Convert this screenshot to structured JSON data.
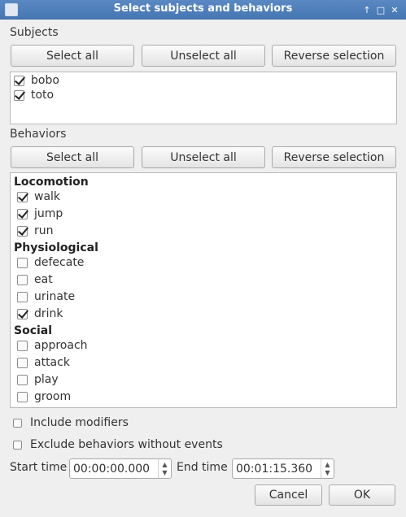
{
  "window": {
    "title": "Select subjects and behaviors",
    "controls": [
      "↑",
      "□",
      "✕"
    ]
  },
  "subjects": {
    "label": "Subjects",
    "select_all": "Select all",
    "unselect_all": "Unselect all",
    "reverse": "Reverse selection",
    "items": [
      {
        "label": "bobo",
        "checked": true
      },
      {
        "label": "toto",
        "checked": true
      }
    ]
  },
  "behaviors": {
    "label": "Behaviors",
    "select_all": "Select all",
    "unselect_all": "Unselect all",
    "reverse": "Reverse selection",
    "groups": [
      {
        "name": "Locomotion",
        "items": [
          {
            "label": "walk",
            "checked": true
          },
          {
            "label": "jump",
            "checked": true
          },
          {
            "label": "run",
            "checked": true
          }
        ]
      },
      {
        "name": "Physiological",
        "items": [
          {
            "label": "defecate",
            "checked": false
          },
          {
            "label": "eat",
            "checked": false
          },
          {
            "label": "urinate",
            "checked": false
          },
          {
            "label": "drink",
            "checked": true
          }
        ]
      },
      {
        "name": "Social",
        "items": [
          {
            "label": "approach",
            "checked": false
          },
          {
            "label": "attack",
            "checked": false
          },
          {
            "label": "play",
            "checked": false
          },
          {
            "label": "groom",
            "checked": false
          }
        ]
      }
    ]
  },
  "options": {
    "include_modifiers": {
      "label": "Include modifiers",
      "checked": false
    },
    "exclude_no_events": {
      "label": "Exclude behaviors without events",
      "checked": false
    }
  },
  "time": {
    "start_label": "Start time",
    "start_value": "00:00:00.000",
    "end_label": "End time",
    "end_value": "00:01:15.360"
  },
  "actions": {
    "cancel": "Cancel",
    "ok": "OK"
  }
}
